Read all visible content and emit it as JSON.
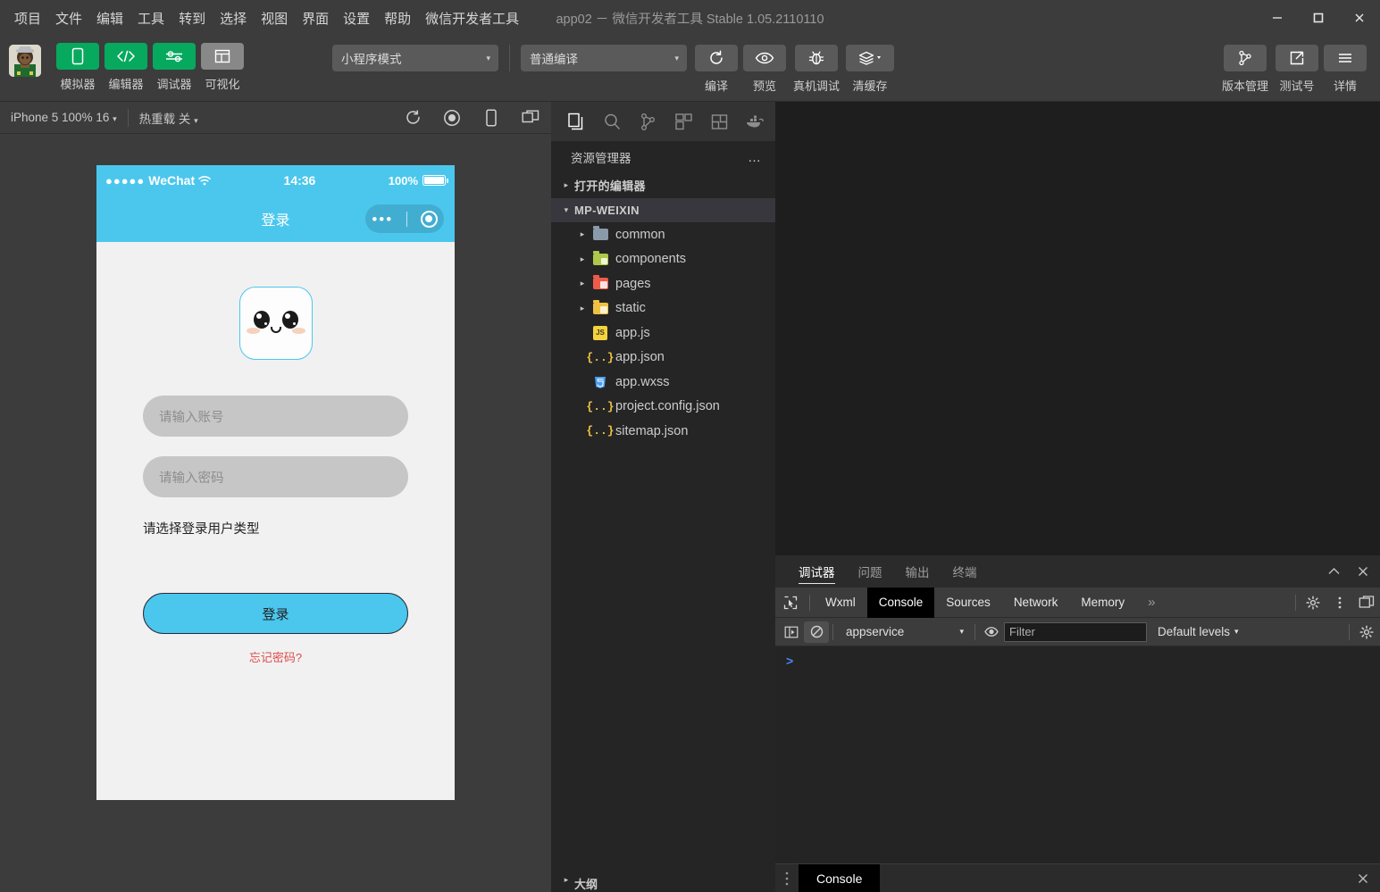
{
  "window": {
    "title": "app02 － 微信开发者工具 Stable 1.05.2110110",
    "minimize_label": "−",
    "maximize_label": "□",
    "close_label": "✕"
  },
  "menu": {
    "items": [
      {
        "label": "项目"
      },
      {
        "label": "文件"
      },
      {
        "label": "编辑"
      },
      {
        "label": "工具"
      },
      {
        "label": "转到"
      },
      {
        "label": "选择"
      },
      {
        "label": "视图"
      },
      {
        "label": "界面"
      },
      {
        "label": "设置"
      },
      {
        "label": "帮助"
      },
      {
        "label": "微信开发者工具"
      }
    ]
  },
  "toolbar": {
    "left_buttons": [
      {
        "label": "模拟器",
        "icon": "phone-icon",
        "style": "green"
      },
      {
        "label": "编辑器",
        "icon": "code-icon",
        "style": "green"
      },
      {
        "label": "调试器",
        "icon": "sliders-icon",
        "style": "green"
      },
      {
        "label": "可视化",
        "icon": "layout-icon",
        "style": "gray"
      }
    ],
    "mode_select": {
      "value": "小程序模式",
      "caret": "▾"
    },
    "compile_select": {
      "value": "普通编译",
      "caret": "▾"
    },
    "action_buttons": [
      {
        "label": "编译",
        "icon": "refresh-icon"
      },
      {
        "label": "预览",
        "icon": "eye-icon"
      },
      {
        "label": "真机调试",
        "icon": "bug-icon"
      },
      {
        "label": "清缓存",
        "icon": "layers-icon",
        "caret": "▾"
      }
    ],
    "right_buttons": [
      {
        "label": "版本管理",
        "icon": "git-branch-icon"
      },
      {
        "label": "测试号",
        "icon": "external-link-icon"
      },
      {
        "label": "详情",
        "icon": "hamburger-icon"
      }
    ]
  },
  "simulator": {
    "device_select": "iPhone 5 100% 16",
    "device_caret": "▾",
    "hot_reload": "热重载 关",
    "hot_reload_caret": "▾",
    "icons": [
      "refresh-icon",
      "record-icon",
      "phone-rotate-icon",
      "multi-window-icon"
    ],
    "phone": {
      "status_bar": {
        "dots": "●●●●●",
        "carrier": "WeChat",
        "wifi": "wifi-icon",
        "time": "14:36",
        "battery_percent": "100%"
      },
      "nav_title": "登录",
      "capsule": {
        "dots": "•••",
        "target": "target-icon"
      },
      "logo": "app-logo-face",
      "account_placeholder": "请输入账号",
      "password_placeholder": "请输入密码",
      "user_type_label": "请选择登录用户类型",
      "login_button": "登录",
      "forgot_password": "忘记密码?"
    }
  },
  "explorer": {
    "activity_icons": [
      {
        "name": "files-icon",
        "active": true
      },
      {
        "name": "search-icon",
        "active": false
      },
      {
        "name": "source-control-icon",
        "active": false
      },
      {
        "name": "extensions-icon",
        "active": false
      },
      {
        "name": "layout-panel-icon",
        "active": false
      },
      {
        "name": "docker-whale-icon",
        "active": false
      }
    ],
    "header": "资源管理器",
    "header_more": "…",
    "sections": [
      {
        "label": "打开的编辑器",
        "twisty": "▸",
        "expanded": false
      },
      {
        "label": "MP-WEIXIN",
        "twisty": "▾",
        "expanded": true
      }
    ],
    "tree": [
      {
        "label": "common",
        "type": "folder",
        "twisty": "▸",
        "color": "#8a9aa8"
      },
      {
        "label": "components",
        "type": "folder",
        "twisty": "▸",
        "color": "#aec84b"
      },
      {
        "label": "pages",
        "type": "folder",
        "twisty": "▸",
        "color": "#ef5b4a"
      },
      {
        "label": "static",
        "type": "folder",
        "twisty": "▸",
        "color": "#f0c244"
      },
      {
        "label": "app.js",
        "type": "file",
        "badge": "JS",
        "color": "#f5d33e",
        "text_color": "#3b3b1c"
      },
      {
        "label": "app.json",
        "type": "file",
        "badge": "{..}",
        "color": "#f0c244"
      },
      {
        "label": "app.wxss",
        "type": "file",
        "badge": "3",
        "color": "#4a9ef0"
      },
      {
        "label": "project.config.json",
        "type": "file",
        "badge": "{..}",
        "color": "#f0c244"
      },
      {
        "label": "sitemap.json",
        "type": "file",
        "badge": "{..}",
        "color": "#f0c244"
      }
    ],
    "outline": {
      "label": "大纲",
      "twisty": "▸"
    }
  },
  "devtools": {
    "panel_tabs": [
      {
        "label": "调试器",
        "active": true
      },
      {
        "label": "问题",
        "active": false
      },
      {
        "label": "输出",
        "active": false
      },
      {
        "label": "终端",
        "active": false
      }
    ],
    "panel_actions": [
      "chevron-up-icon",
      "close-icon"
    ],
    "inspect_icon": "inspect-cursor-icon",
    "tabs": [
      {
        "label": "Wxml",
        "active": false
      },
      {
        "label": "Console",
        "active": true
      },
      {
        "label": "Sources",
        "active": false
      },
      {
        "label": "Network",
        "active": false
      },
      {
        "label": "Memory",
        "active": false
      }
    ],
    "tabs_more": "»",
    "tab_actions": [
      "settings-gear-icon",
      "more-vertical-icon",
      "dock-icon"
    ],
    "console_bar": {
      "sidebar_toggle": "console-sidebar-icon",
      "clear": "clear-console-icon",
      "context": "appservice",
      "context_caret": "▾",
      "eye": "live-expression-icon",
      "filter_placeholder": "Filter",
      "filter_value": "",
      "levels": "Default levels",
      "levels_caret": "▾",
      "settings": "settings-gear-icon"
    },
    "prompt": ">"
  },
  "bottom_bar": {
    "grip": "⋮",
    "console_label": "Console",
    "close": "✕"
  },
  "colors": {
    "accent_green": "#07a95e",
    "wechat_blue": "#4bc7ee",
    "error_red": "#e04a4a",
    "panel_dark": "#252526",
    "editor_dark": "#1e1e1e"
  }
}
